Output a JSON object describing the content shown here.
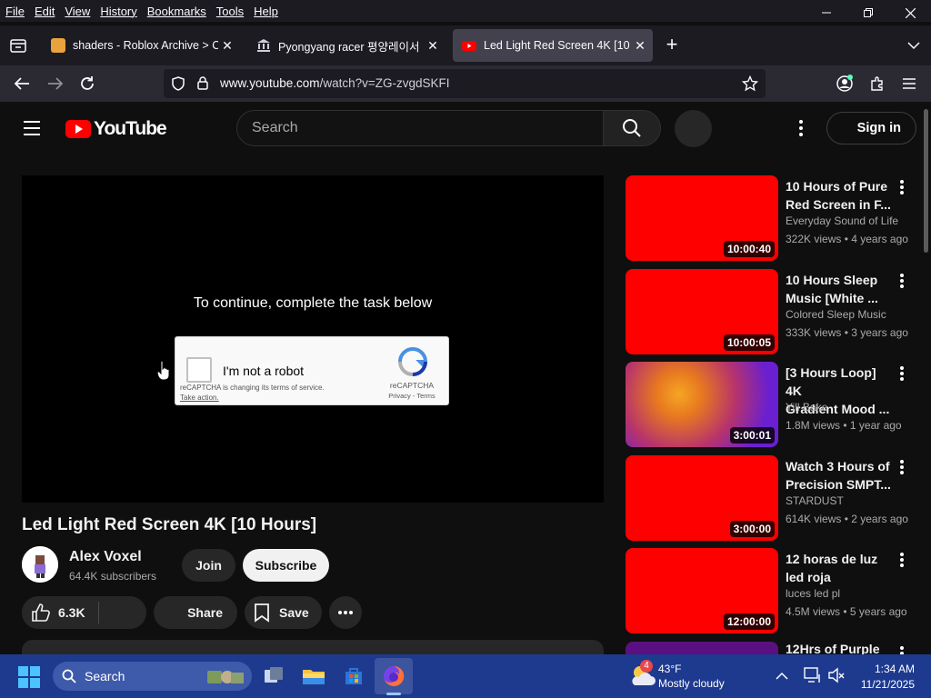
{
  "menubar": {
    "items": [
      "File",
      "Edit",
      "View",
      "History",
      "Bookmarks",
      "Tools",
      "Help"
    ]
  },
  "tabs": [
    {
      "title": "shaders - Roblox Archive > Clie",
      "favicon_color": "#e8a33d"
    },
    {
      "title": "Pyongyang racer 평양레이서 : F",
      "favicon_color": "#cfcfd8"
    },
    {
      "title": "Led Light Red Screen 4K [10 Ho",
      "favicon_color": "#ff0000",
      "active": true
    }
  ],
  "address": {
    "host": "www.youtube.com",
    "path": "/watch?v=ZG-zvgdSKFI"
  },
  "youtube": {
    "logo_text": "YouTube",
    "search_placeholder": "Search",
    "sign_in": "Sign in"
  },
  "player": {
    "prompt": "To continue, complete the task below",
    "captcha": {
      "label": "I'm not a robot",
      "notice": "reCAPTCHA is changing its terms of service.",
      "take_action": "Take action.",
      "brand": "reCAPTCHA",
      "privacy_terms": "Privacy - Terms"
    }
  },
  "video": {
    "title": "Led Light Red Screen 4K [10 Hours]",
    "channel": "Alex Voxel",
    "subscribers": "64.4K subscribers",
    "join": "Join",
    "subscribe": "Subscribe",
    "likes": "6.3K",
    "share": "Share",
    "save": "Save"
  },
  "recommendations": [
    {
      "title": "10 Hours of Pure\nRed Screen in F...",
      "channel": "Everyday Sound of Life",
      "meta": "322K views • 4 years ago",
      "duration": "10:00:40",
      "thumb": "red"
    },
    {
      "title": "10 Hours Sleep\nMusic [White ...",
      "channel": "Colored Sleep Music",
      "meta": "333K views • 3 years ago",
      "duration": "10:00:05",
      "thumb": "red"
    },
    {
      "title": "[3 Hours Loop] 4K\nGradient Mood ...",
      "channel": "Yill Bake",
      "meta": "1.8M views • 1 year ago",
      "duration": "3:00:01",
      "thumb": "gradient"
    },
    {
      "title": "Watch 3 Hours of\nPrecision SMPT...",
      "channel": "STARDUST",
      "meta": "614K views • 2 years ago",
      "duration": "3:00:00",
      "thumb": "red"
    },
    {
      "title": "12 horas de luz\nled roja",
      "channel": "luces led pl",
      "meta": "4.5M views • 5 years ago",
      "duration": "12:00:00",
      "thumb": "red"
    },
    {
      "title": "12Hrs of Purple",
      "channel": "",
      "meta": "",
      "duration": "",
      "thumb": "purple"
    }
  ],
  "taskbar": {
    "search": "Search",
    "weather_temp": "43°F",
    "weather_cond": "Mostly cloudy",
    "weather_badge": "4",
    "time": "1:34 AM",
    "date": "11/21/2025"
  },
  "colors": {
    "youtube_red": "#ff0000",
    "taskbar": "#1e3a8f",
    "browser_chrome": "#1c1b22"
  }
}
